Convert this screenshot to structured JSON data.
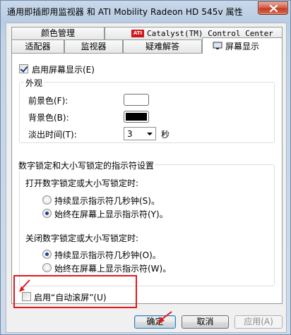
{
  "window": {
    "title": "通用即插即用监视器 和 ATI Mobility Radeon HD 545v 属性",
    "close_glyph": "x"
  },
  "tabs": {
    "row_back": [
      {
        "label": "颜色管理"
      },
      {
        "label": "Catalyst(TM) Control Center",
        "icon": "ati-logo-icon",
        "icon_text": "ATI"
      }
    ],
    "row_front": [
      {
        "label": "适配器"
      },
      {
        "label": "监视器"
      },
      {
        "label": "疑难解答"
      },
      {
        "label": "屏幕显示",
        "icon": "monitor-icon",
        "active": true
      }
    ]
  },
  "osd": {
    "enable_label": "启用屏幕显示(E)",
    "enable_checked": true
  },
  "appearance": {
    "title": "外观",
    "foreground_label": "前景色(F):",
    "foreground_color": "#ffffff",
    "background_label": "背景色(B):",
    "background_color": "#000000",
    "fade_label": "淡出时间(T):",
    "fade_value": "3",
    "fade_unit": "秒"
  },
  "lock_indicator": {
    "title": "数字锁定和大小写锁定的指示符设置",
    "on_title": "打开数字锁定或大小写锁定时:",
    "on_options": [
      {
        "label": "持续显示指示符几秒钟(S)。",
        "checked": false
      },
      {
        "label": "始终在屏幕上显示指示符(Y)。",
        "checked": true
      }
    ],
    "off_title": "关闭数字锁定或大小写锁定时:",
    "off_options": [
      {
        "label": "持续显示指示符几秒钟(O)。",
        "checked": true
      },
      {
        "label": "始终在屏幕上显示指示符(W)。",
        "checked": false
      }
    ]
  },
  "autoscroll": {
    "label": "启用“自动滚屏”(U)",
    "checked": false
  },
  "buttons": {
    "ok": "确定",
    "cancel": "取消",
    "apply": "应用(A)"
  },
  "annotation_color": "#e0191c"
}
